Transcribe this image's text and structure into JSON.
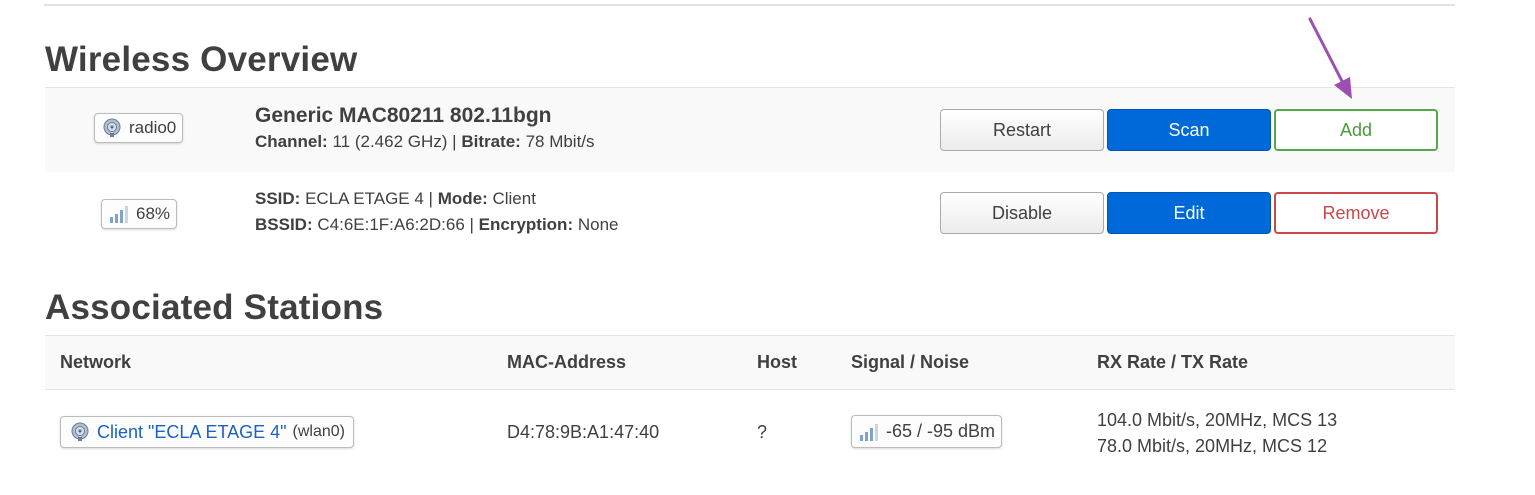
{
  "wireless_overview": {
    "title": "Wireless Overview",
    "radio": {
      "badge_label": "radio0",
      "device_name": "Generic MAC80211 802.11bgn",
      "channel_label": "Channel:",
      "channel_value": "11 (2.462 GHz)",
      "bitrate_label": "Bitrate:",
      "bitrate_value": "78 Mbit/s",
      "buttons": {
        "restart": "Restart",
        "scan": "Scan",
        "add": "Add"
      }
    },
    "network": {
      "signal_badge": "68%",
      "ssid_label": "SSID:",
      "ssid_value": "ECLA ETAGE 4",
      "mode_label": "Mode:",
      "mode_value": "Client",
      "bssid_label": "BSSID:",
      "bssid_value": "C4:6E:1F:A6:2D:66",
      "encryption_label": "Encryption:",
      "encryption_value": "None",
      "buttons": {
        "disable": "Disable",
        "edit": "Edit",
        "remove": "Remove"
      }
    }
  },
  "associated_stations": {
    "title": "Associated Stations",
    "columns": [
      "Network",
      "MAC-Address",
      "Host",
      "Signal / Noise",
      "RX Rate / TX Rate"
    ],
    "rows": [
      {
        "network_link": "Client \"ECLA ETAGE 4\"",
        "interface": "(wlan0)",
        "mac": "D4:78:9B:A1:47:40",
        "host": "?",
        "signal_noise": "-65 / -95 dBm",
        "rx_rate": "104.0 Mbit/s, 20MHz, MCS 13",
        "tx_rate": "78.0 Mbit/s, 20MHz, MCS 12"
      }
    ]
  },
  "icons": [
    "wifi-radio-icon",
    "signal-bars-icon",
    "annotation-arrow"
  ],
  "colors": {
    "primary": "#0069d9",
    "success": "#56a94a",
    "danger": "#c9484a",
    "arrow": "#9b4fb0"
  }
}
